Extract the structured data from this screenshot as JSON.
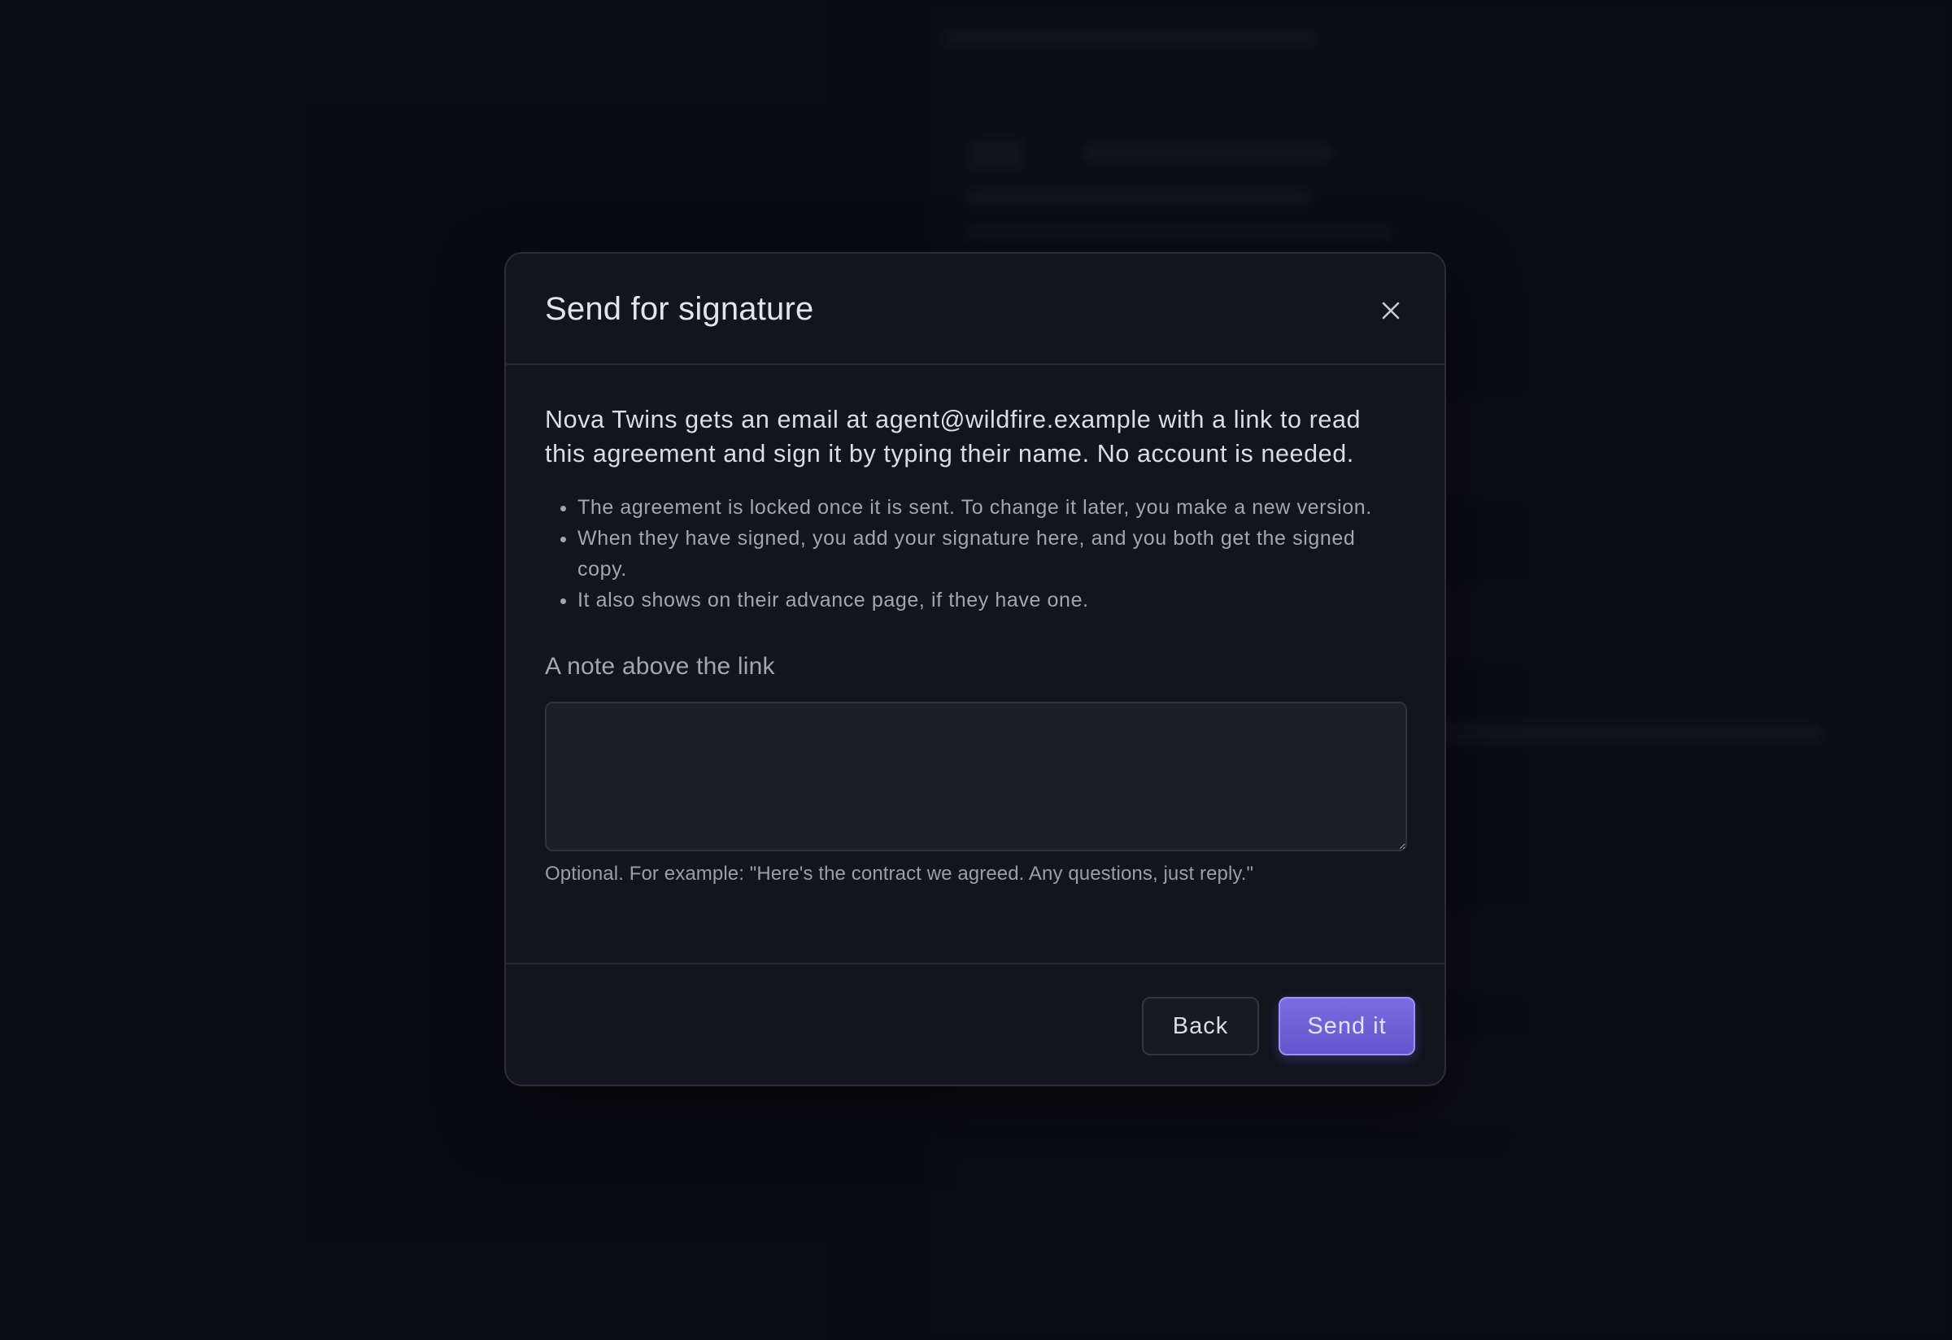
{
  "dialog": {
    "title": "Send for signature",
    "intro": "Nova Twins gets an email at agent@wildfire.example with a link to read this agreement and sign it by typing their name. No account is needed.",
    "points": [
      "The agreement is locked once it is sent. To change it later, you make a new version.",
      "When they have signed, you add your signature here, and you both get the signed copy.",
      "It also shows on their advance page, if they have one."
    ],
    "note": {
      "label": "A note above the link",
      "value": "",
      "helper": "Optional. For example: \"Here's the contract we agreed. Any questions, just reply.\""
    },
    "buttons": {
      "back": "Back",
      "send": "Send it"
    },
    "icons": {
      "close": "close-icon"
    }
  },
  "colors": {
    "accent": "#6b5fd6",
    "background": "#0c0c15",
    "surface": "#14141e"
  }
}
